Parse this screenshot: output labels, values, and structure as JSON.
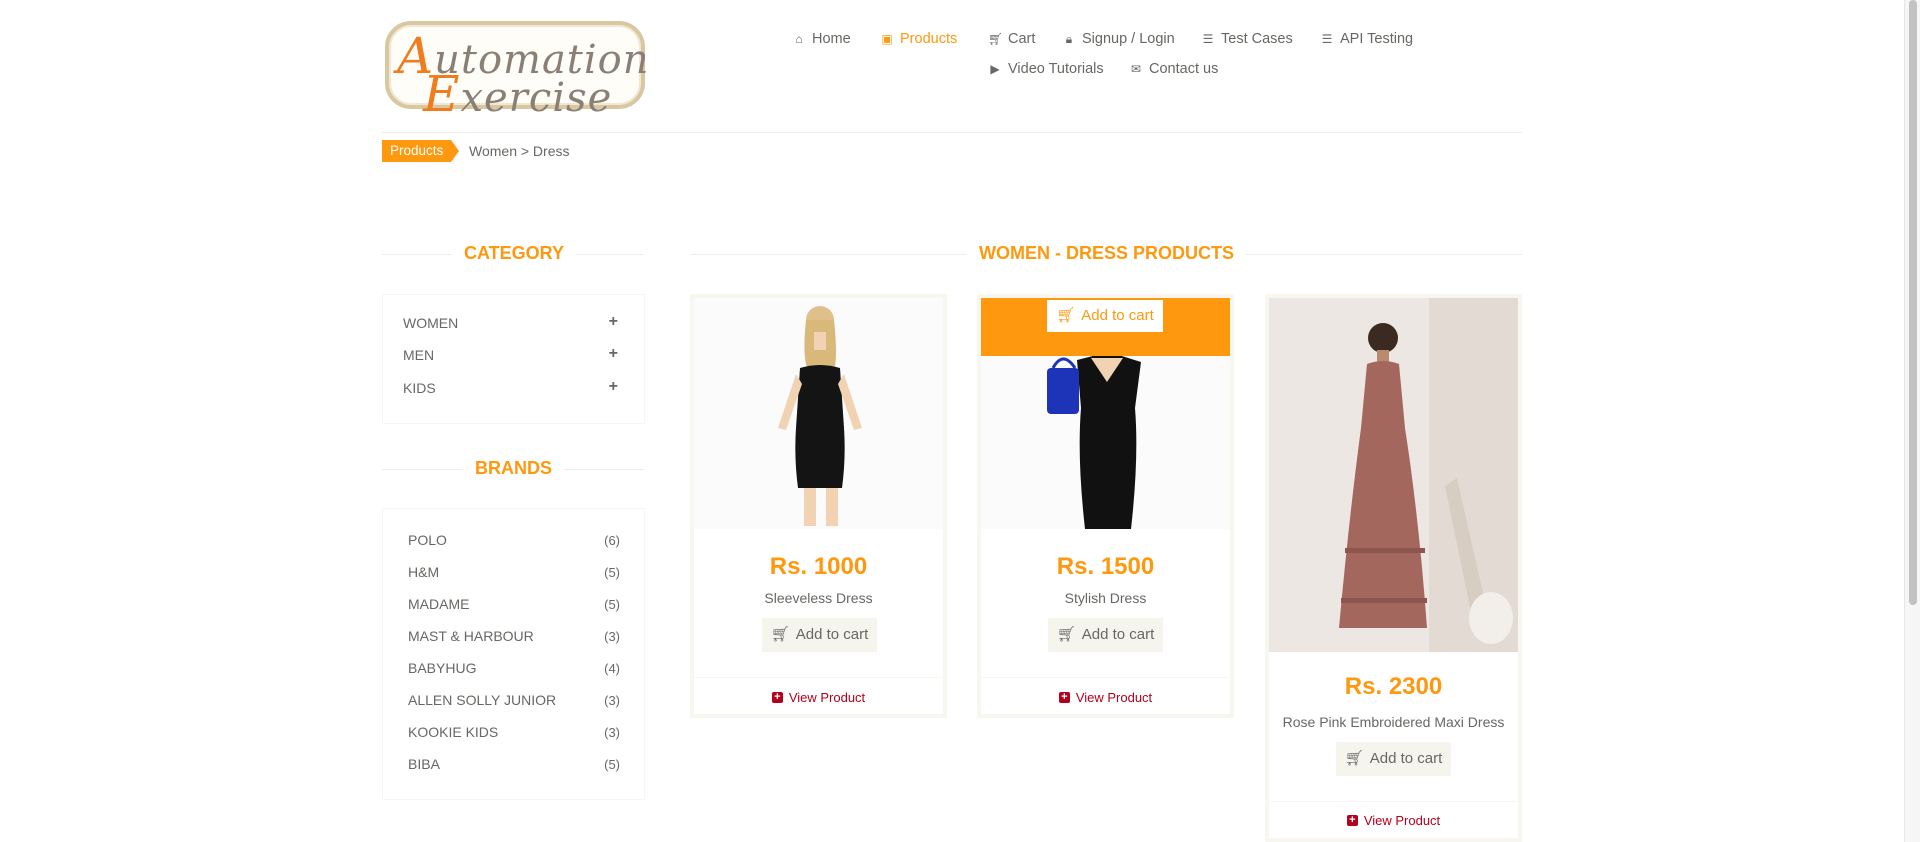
{
  "logo": {
    "line1_cap": "A",
    "line1_rest": "utomation",
    "line2_cap": "E",
    "line2_rest": "xercise"
  },
  "nav": {
    "home": "Home",
    "products": "Products",
    "cart": "Cart",
    "login": "Signup / Login",
    "test_cases": "Test Cases",
    "api_testing": "API Testing",
    "video": "Video Tutorials",
    "contact": "Contact us"
  },
  "breadcrumb": {
    "tag": "Products",
    "path": "Women > Dress"
  },
  "sidebar": {
    "category_title": "CATEGORY",
    "categories": [
      "WOMEN",
      "MEN",
      "KIDS"
    ],
    "brands_title": "BRANDS",
    "brands": [
      {
        "name": "POLO",
        "count": "(6)"
      },
      {
        "name": "H&M",
        "count": "(5)"
      },
      {
        "name": "MADAME",
        "count": "(5)"
      },
      {
        "name": "MAST & HARBOUR",
        "count": "(3)"
      },
      {
        "name": "BABYHUG",
        "count": "(4)"
      },
      {
        "name": "ALLEN SOLLY JUNIOR",
        "count": "(3)"
      },
      {
        "name": "KOOKIE KIDS",
        "count": "(3)"
      },
      {
        "name": "BIBA",
        "count": "(5)"
      }
    ]
  },
  "main": {
    "title": "WOMEN - DRESS PRODUCTS",
    "products": [
      {
        "price": "Rs. 1000",
        "name": "Sleeveless Dress",
        "add": "Add to cart",
        "view": "View Product"
      },
      {
        "price": "Rs. 1500",
        "name": "Stylish Dress",
        "add": "Add to cart",
        "overlay_add": "Add to cart",
        "view": "View Product"
      },
      {
        "price": "Rs. 2300",
        "name": "Rose Pink Embroidered Maxi Dress",
        "add": "Add to cart",
        "view": "View Product"
      }
    ]
  },
  "colors": {
    "accent": "#FE980F",
    "link": "#B3001B",
    "text": "#696763",
    "button_bg": "#F5F5ED"
  }
}
